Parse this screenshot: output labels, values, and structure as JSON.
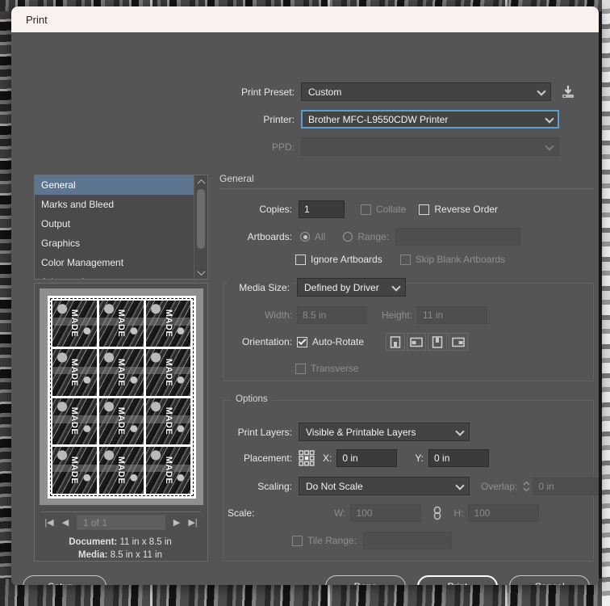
{
  "window": {
    "title": "Print"
  },
  "top": {
    "print_preset_label": "Print Preset:",
    "print_preset_value": "Custom",
    "save_preset_icon": "save-preset-icon",
    "printer_label": "Printer:",
    "printer_value": "Brother MFC-L9550CDW Printer",
    "ppd_label": "PPD:",
    "ppd_value": ""
  },
  "nav": {
    "items": [
      {
        "label": "General",
        "selected": true
      },
      {
        "label": "Marks and Bleed",
        "selected": false
      },
      {
        "label": "Output",
        "selected": false
      },
      {
        "label": "Graphics",
        "selected": false
      },
      {
        "label": "Color Management",
        "selected": false
      },
      {
        "label": "Advanced",
        "selected": false
      }
    ]
  },
  "preview": {
    "tile_word": "MADE",
    "tile_count": 12,
    "page_nav": {
      "first": "|◀",
      "prev": "◀",
      "value": "1 of 1",
      "next": "▶",
      "last": "▶|"
    },
    "document_label": "Document:",
    "document_value": "11 in x 8.5 in",
    "media_label": "Media:",
    "media_value": "8.5 in x 11 in"
  },
  "general": {
    "section_title": "General",
    "copies_label": "Copies:",
    "copies_value": "1",
    "collate_label": "Collate",
    "collate_checked": false,
    "collate_disabled": true,
    "reverse_order_label": "Reverse Order",
    "reverse_order_checked": false,
    "artboards_label": "Artboards:",
    "all_label": "All",
    "all_selected": true,
    "range_label": "Range:",
    "range_value": "",
    "ignore_artboards_label": "Ignore Artboards",
    "ignore_artboards_checked": false,
    "skip_blank_label": "Skip Blank Artboards",
    "skip_blank_checked": false,
    "skip_blank_disabled": true,
    "media_size_label": "Media Size:",
    "media_size_value": "Defined by Driver",
    "width_label": "Width:",
    "width_value": "8.5 in",
    "height_label": "Height:",
    "height_value": "11 in",
    "orientation_label": "Orientation:",
    "auto_rotate_label": "Auto-Rotate",
    "auto_rotate_checked": true,
    "orientation_buttons": [
      "orientation-portrait-icon",
      "orientation-landscape-left-icon",
      "orientation-portrait-flipped-icon",
      "orientation-landscape-right-icon"
    ],
    "transverse_label": "Transverse",
    "transverse_checked": false,
    "transverse_disabled": true
  },
  "options": {
    "section_title": "Options",
    "print_layers_label": "Print Layers:",
    "print_layers_value": "Visible & Printable Layers",
    "placement_label": "Placement:",
    "placement_icon": "placement-anchor-grid-icon",
    "x_label": "X:",
    "x_value": "0 in",
    "y_label": "Y:",
    "y_value": "0 in",
    "scaling_label": "Scaling:",
    "scaling_value": "Do Not Scale",
    "overlap_label": "Overlap:",
    "overlap_value": "0 in",
    "scale_label": "Scale:",
    "scale_w_label": "W:",
    "scale_w_value": "100",
    "link_icon": "link-chain-icon",
    "scale_h_label": "H:",
    "scale_h_value": "100",
    "tile_range_label": "Tile Range:",
    "tile_range_value": "",
    "tile_range_checked": false
  },
  "footer": {
    "setup_label": "Setup...",
    "done_label": "Done",
    "print_label": "Print",
    "cancel_label": "Cancel"
  },
  "colors": {
    "dialog_bg": "#555555",
    "titlebar_bg": "#f9f1ee",
    "selection_blue": "#5d7591",
    "focus_blue": "#5a9fd4"
  }
}
